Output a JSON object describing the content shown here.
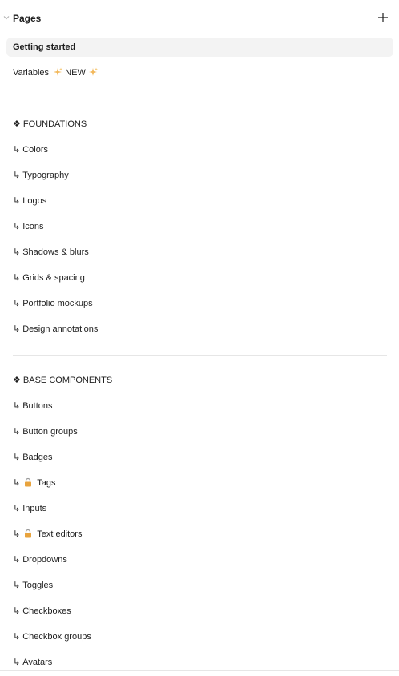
{
  "panel": {
    "title": "Pages",
    "add_label": "+"
  },
  "pages": {
    "getting_started": "Getting started",
    "variables_label": "Variables",
    "variables_badge": "NEW",
    "foundations_header": "❖ FOUNDATIONS",
    "base_components_header": "❖ BASE COMPONENTS",
    "arrow": "↳",
    "foundations": [
      "Colors",
      "Typography",
      "Logos",
      "Icons",
      "Shadows & blurs",
      "Grids & spacing",
      "Portfolio mockups",
      "Design annotations"
    ],
    "base_components": [
      "Buttons",
      "Button groups",
      "Badges",
      "Tags",
      "Inputs",
      "Text editors",
      "Dropdowns",
      "Toggles",
      "Checkboxes",
      "Checkbox groups",
      "Avatars"
    ]
  },
  "icons": {
    "collapse": "chevron-down-icon",
    "add": "plus-icon",
    "sparkle": "sparkles-icon",
    "lock": "lock-icon"
  },
  "colors": {
    "text": "#1e1e1e",
    "selected_bg": "#f3f3f3",
    "divider": "#e6e6e6",
    "lock": "#e8a33d",
    "sparkle": "#f2b85b"
  }
}
